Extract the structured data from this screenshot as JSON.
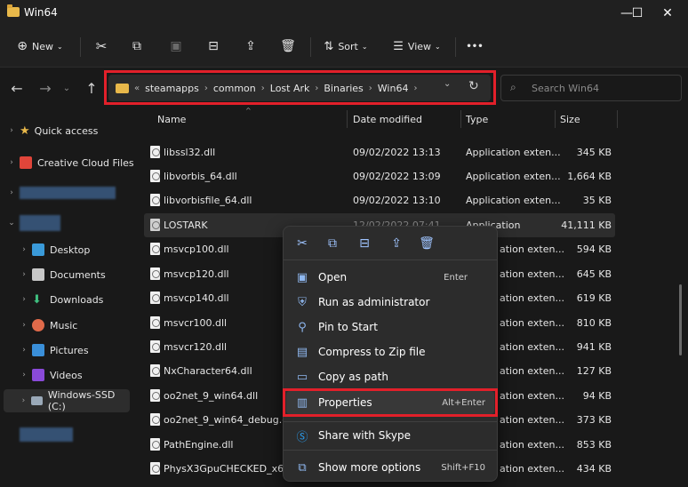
{
  "window": {
    "title": "Win64",
    "minimize": "—",
    "maximize": "☐",
    "close": "✕"
  },
  "toolbar": {
    "new_label": "New",
    "sort_label": "Sort",
    "view_label": "View",
    "more_label": "•••"
  },
  "address": {
    "overflow": "«",
    "crumbs": [
      "steamapps",
      "common",
      "Lost Ark",
      "Binaries",
      "Win64"
    ],
    "search_placeholder": "Search Win64"
  },
  "sidebar": {
    "items": [
      {
        "label": "Quick access",
        "icon": "star-icon"
      },
      {
        "label": "Creative Cloud Files",
        "icon": "creative-cloud-icon"
      },
      {
        "label": "",
        "icon": "cloud-icon"
      },
      {
        "label": "",
        "icon": "pc-icon"
      },
      {
        "label": "Desktop",
        "icon": "desktop-icon"
      },
      {
        "label": "Documents",
        "icon": "documents-icon"
      },
      {
        "label": "Downloads",
        "icon": "downloads-icon"
      },
      {
        "label": "Music",
        "icon": "music-icon"
      },
      {
        "label": "Pictures",
        "icon": "pictures-icon"
      },
      {
        "label": "Videos",
        "icon": "videos-icon"
      },
      {
        "label": "Windows-SSD (C:)",
        "icon": "drive-icon"
      },
      {
        "label": "",
        "icon": "network-icon"
      }
    ]
  },
  "columns": {
    "name": "Name",
    "date": "Date modified",
    "type": "Type",
    "size": "Size"
  },
  "files": [
    {
      "name": "libssl32.dll",
      "date": "09/02/2022 13:13",
      "type": "Application exten...",
      "size": "345 KB"
    },
    {
      "name": "libvorbis_64.dll",
      "date": "09/02/2022 13:09",
      "type": "Application exten...",
      "size": "1,664 KB"
    },
    {
      "name": "libvorbisfile_64.dll",
      "date": "09/02/2022 13:10",
      "type": "Application exten...",
      "size": "35 KB"
    },
    {
      "name": "LOSTARK",
      "date": "12/02/2022 07:41",
      "type": "Application",
      "size": "41,111 KB"
    },
    {
      "name": "msvcp100.dll",
      "date": "",
      "type": "ation exten...",
      "size": "594 KB"
    },
    {
      "name": "msvcp120.dll",
      "date": "",
      "type": "ation exten...",
      "size": "645 KB"
    },
    {
      "name": "msvcp140.dll",
      "date": "",
      "type": "ation exten...",
      "size": "619 KB"
    },
    {
      "name": "msvcr100.dll",
      "date": "",
      "type": "ation exten...",
      "size": "810 KB"
    },
    {
      "name": "msvcr120.dll",
      "date": "",
      "type": "ation exten...",
      "size": "941 KB"
    },
    {
      "name": "NxCharacter64.dll",
      "date": "",
      "type": "ation exten...",
      "size": "127 KB"
    },
    {
      "name": "oo2net_9_win64.dll",
      "date": "",
      "type": "ation exten...",
      "size": "94 KB"
    },
    {
      "name": "oo2net_9_win64_debug.dll",
      "date": "",
      "type": "ation exten...",
      "size": "373 KB"
    },
    {
      "name": "PathEngine.dll",
      "date": "",
      "type": "ation exten...",
      "size": "853 KB"
    },
    {
      "name": "PhysX3GpuCHECKED_x64.dll",
      "date": "",
      "type": "ation exten...",
      "size": "434 KB"
    }
  ],
  "context_menu": {
    "items": [
      {
        "label": "Open",
        "shortcut": "Enter"
      },
      {
        "label": "Run as administrator",
        "shortcut": ""
      },
      {
        "label": "Pin to Start",
        "shortcut": ""
      },
      {
        "label": "Compress to Zip file",
        "shortcut": ""
      },
      {
        "label": "Copy as path",
        "shortcut": ""
      },
      {
        "label": "Properties",
        "shortcut": "Alt+Enter"
      },
      {
        "label": "Share with Skype",
        "shortcut": ""
      },
      {
        "label": "Show more options",
        "shortcut": "Shift+F10"
      }
    ]
  },
  "colors": {
    "highlight": "#e2202a",
    "accent": "#8fb8f0",
    "folder": "#e8b84a"
  }
}
